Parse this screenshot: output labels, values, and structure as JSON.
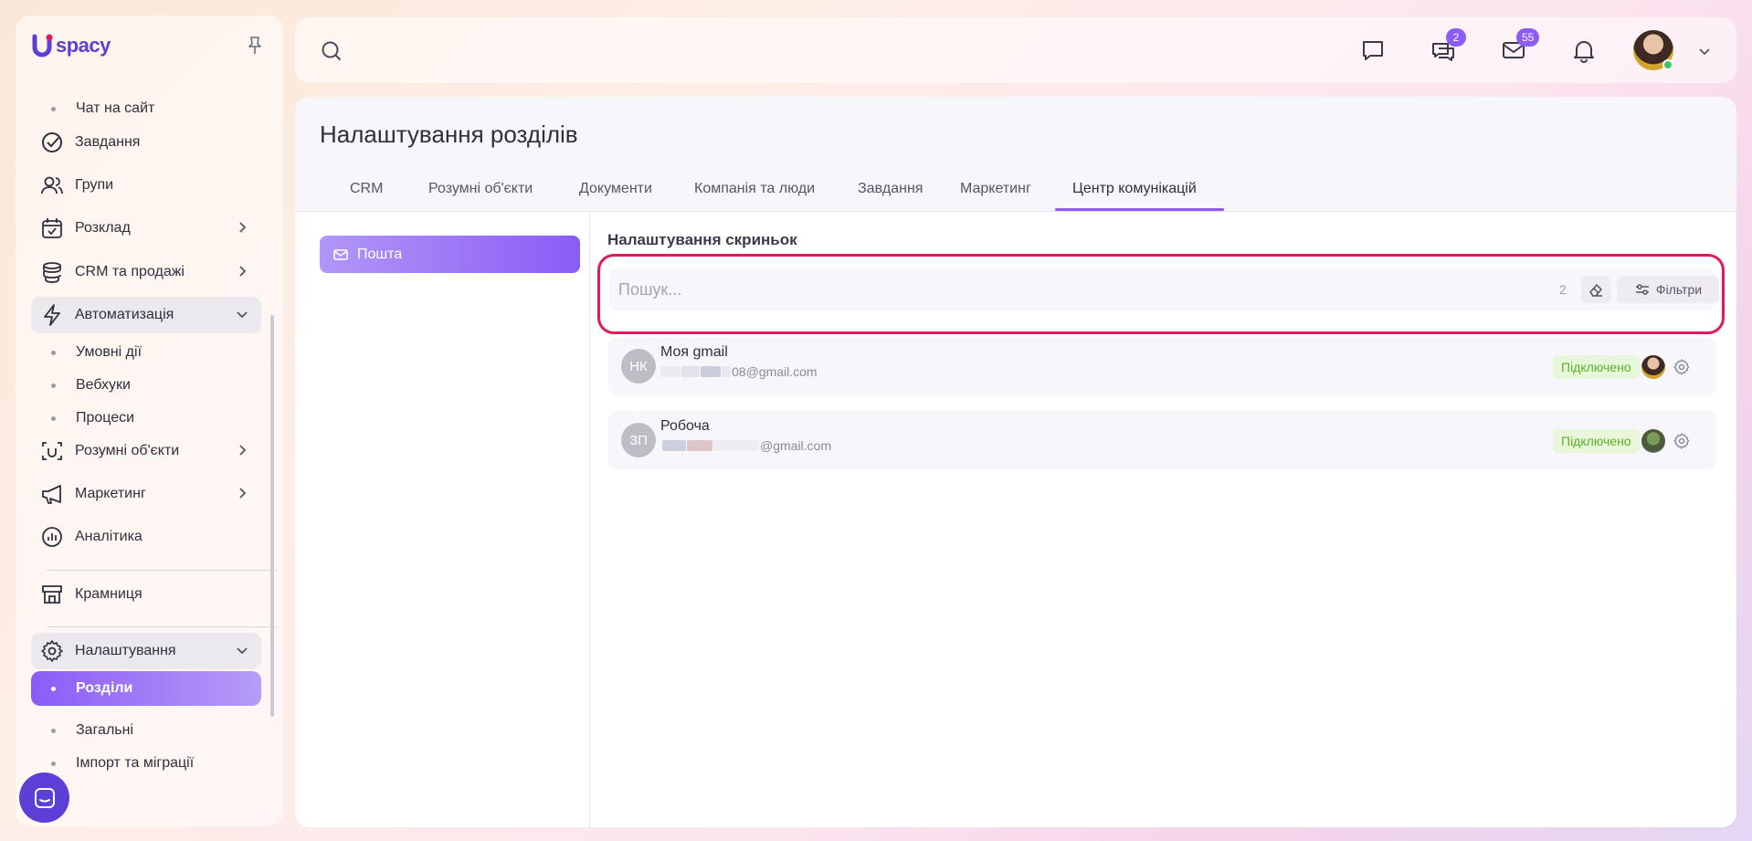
{
  "app": {
    "logo_text": "spacy"
  },
  "sidebar": {
    "items": [
      {
        "label": "Чат на сайт"
      },
      {
        "label": "Завдання"
      },
      {
        "label": "Групи"
      },
      {
        "label": "Розклад"
      },
      {
        "label": "CRM та продажі"
      },
      {
        "label": "Автоматизація"
      },
      {
        "label": "Умовні дії"
      },
      {
        "label": "Вебхуки"
      },
      {
        "label": "Процеси"
      },
      {
        "label": "Розумні об'єкти"
      },
      {
        "label": "Маркетинг"
      },
      {
        "label": "Аналітика"
      },
      {
        "label": "Крамниця"
      },
      {
        "label": "Налаштування"
      },
      {
        "label": "Розділи"
      },
      {
        "label": "Загальні"
      },
      {
        "label": "Імпорт та міграції"
      }
    ]
  },
  "topbar": {
    "chats_badge": "2",
    "mail_badge": "55",
    "icons": [
      "search-icon",
      "message-icon",
      "chats-icon",
      "mail-icon",
      "bell-icon"
    ]
  },
  "main": {
    "title": "Налаштування розділів",
    "tabs": [
      {
        "label": "CRM"
      },
      {
        "label": "Розумні об'єкти"
      },
      {
        "label": "Документи"
      },
      {
        "label": "Компанія та люди"
      },
      {
        "label": "Завдання"
      },
      {
        "label": "Маркетинг"
      },
      {
        "label": "Центр комунікацій"
      }
    ],
    "active_tab": "Центр комунікацій",
    "left_nav": {
      "mail_label": "Пошта"
    },
    "section_title": "Налаштування скриньок",
    "search": {
      "placeholder": "Пошук...",
      "count": "2",
      "filter_label": "Фільтри"
    },
    "mailboxes": [
      {
        "initials": "НК",
        "name": "Моя gmail",
        "email_visible": "08@gmail.com",
        "status": "Підключено"
      },
      {
        "initials": "ЗП",
        "name": "Робоча",
        "email_visible": "@gmail.com",
        "status": "Підключено"
      }
    ]
  },
  "colors": {
    "accent": "#8b5cf6",
    "highlight": "#e0195c",
    "status_green": "#5ab02c"
  }
}
